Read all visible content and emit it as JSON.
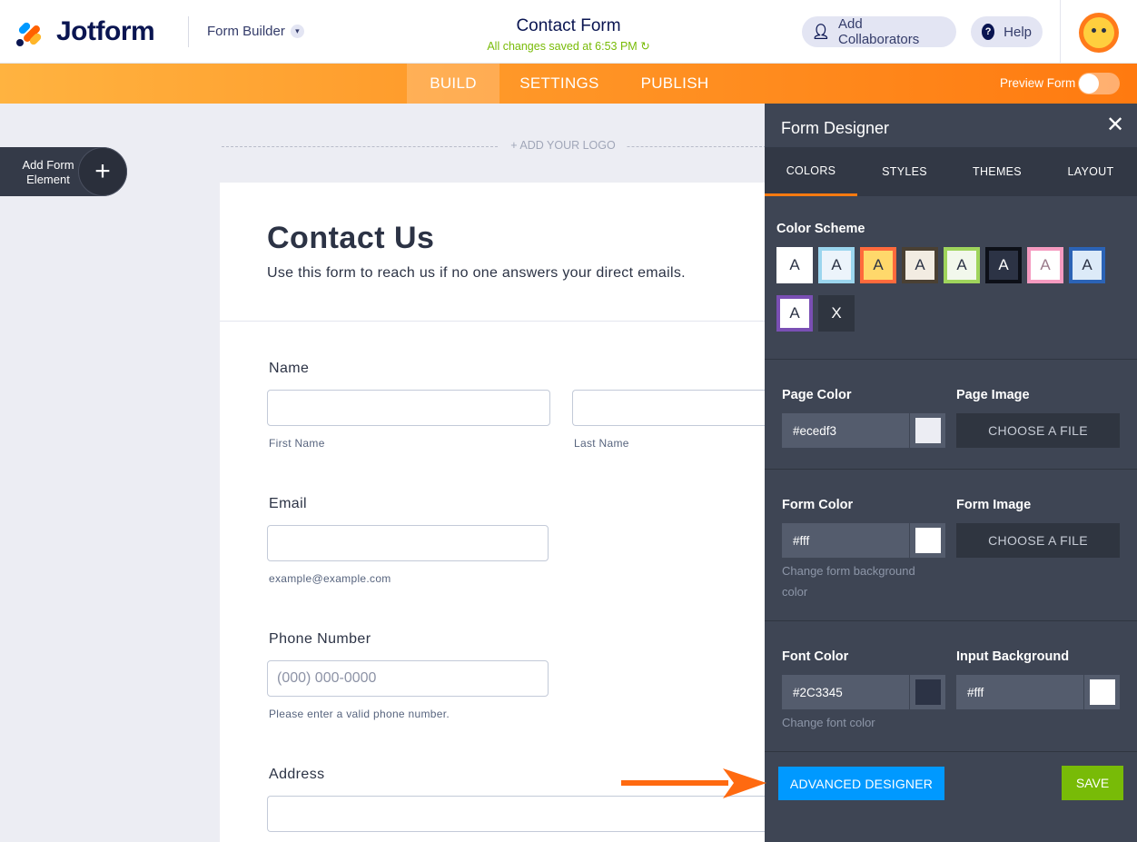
{
  "header": {
    "brand": "Jotform",
    "builder_menu": "Form Builder",
    "form_title": "Contact Form",
    "saved_status": "All changes saved at 6:53 PM",
    "add_collaborators": "Add Collaborators",
    "help": "Help"
  },
  "nav": {
    "tabs": [
      "BUILD",
      "SETTINGS",
      "PUBLISH"
    ],
    "active_tab": "BUILD",
    "preview_label": "Preview Form",
    "preview_on": false
  },
  "canvas": {
    "add_element_label": "Add Form Element",
    "add_logo": "+ ADD YOUR LOGO"
  },
  "form": {
    "title": "Contact Us",
    "subtitle": "Use this form to reach us if no one answers your direct emails.",
    "fields": {
      "name_label": "Name",
      "first_name_sub": "First Name",
      "last_name_sub": "Last Name",
      "email_label": "Email",
      "email_sub": "example@example.com",
      "phone_label": "Phone Number",
      "phone_placeholder": "(000) 000-0000",
      "phone_sub": "Please enter a valid phone number.",
      "address_label": "Address"
    }
  },
  "designer": {
    "title": "Form Designer",
    "tabs": [
      "COLORS",
      "STYLES",
      "THEMES",
      "LAYOUT"
    ],
    "active_tab": "COLORS",
    "color_scheme_label": "Color Scheme",
    "schemes": [
      {
        "letter": "A",
        "bg": "#ffffff",
        "border": "#ffffff",
        "fg": "#2c3345"
      },
      {
        "letter": "A",
        "bg": "#ecf4fb",
        "border": "#9bd5ee",
        "fg": "#2c3345"
      },
      {
        "letter": "A",
        "bg": "#ffd86b",
        "border": "#ff6a3c",
        "fg": "#2c3345"
      },
      {
        "letter": "A",
        "bg": "#f2ece2",
        "border": "#4a4033",
        "fg": "#2c3345"
      },
      {
        "letter": "A",
        "bg": "#f2f8ec",
        "border": "#9fd45c",
        "fg": "#2c3345"
      },
      {
        "letter": "A",
        "bg": "#2c3345",
        "border": "#0d1018",
        "fg": "#ffffff"
      },
      {
        "letter": "A",
        "bg": "#ffffff",
        "border": "#f59ac0",
        "fg": "#9a7a8a"
      },
      {
        "letter": "A",
        "bg": "#dceaf8",
        "border": "#2b63b6",
        "fg": "#2c3345"
      },
      {
        "letter": "A",
        "bg": "#ffffff",
        "border": "#7a4fb4",
        "fg": "#2c3345"
      },
      {
        "letter": "X",
        "bg": "#2f3540",
        "border": "#2f3540",
        "fg": "#ffffff"
      }
    ],
    "page_color_label": "Page Color",
    "page_color_value": "#ecedf3",
    "page_color_chip": "#ecedf3",
    "page_image_label": "Page Image",
    "choose_file": "CHOOSE A FILE",
    "form_color_label": "Form Color",
    "form_color_value": "#fff",
    "form_color_chip": "#ffffff",
    "form_color_hint": "Change form background color",
    "form_image_label": "Form Image",
    "font_color_label": "Font Color",
    "font_color_value": "#2C3345",
    "font_color_chip": "#2c3345",
    "font_color_hint": "Change font color",
    "input_bg_label": "Input Background",
    "input_bg_value": "#fff",
    "input_bg_chip": "#ffffff",
    "advanced_designer": "ADVANCED DESIGNER",
    "save": "SAVE"
  },
  "colors": {
    "orange": "#ff7a10",
    "accent_blue": "#0099ff",
    "save_green": "#78bb07",
    "panel_bg": "#3e4554"
  }
}
